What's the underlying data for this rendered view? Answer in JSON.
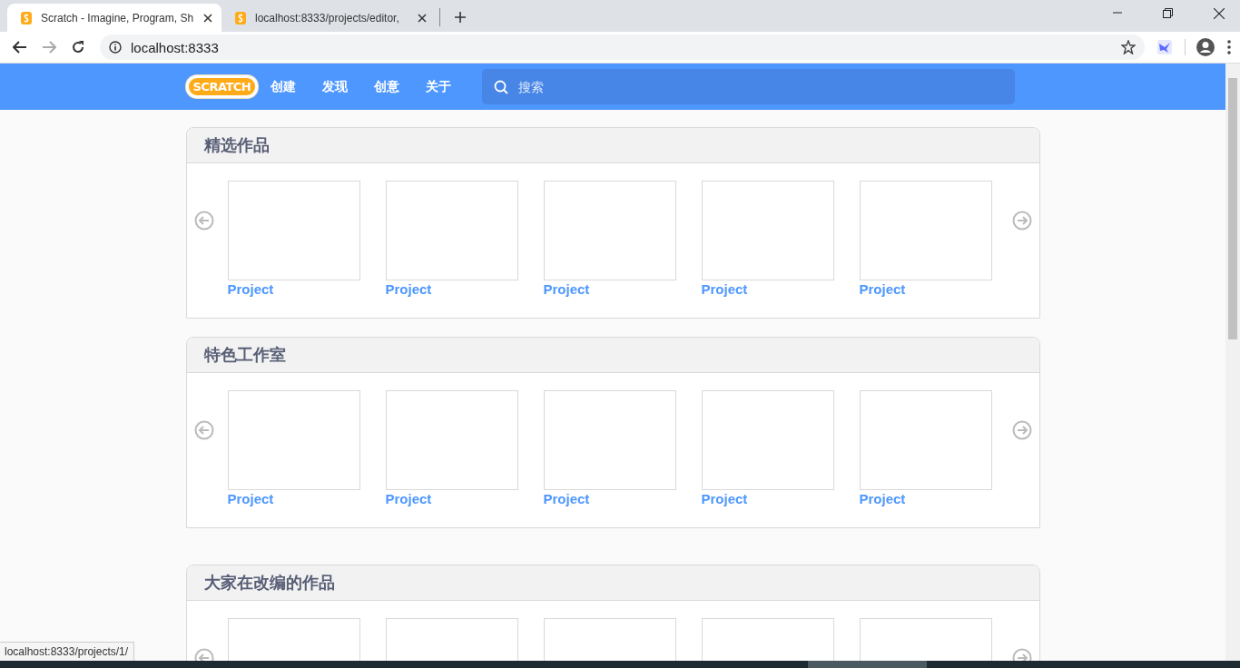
{
  "browser": {
    "tabs": [
      {
        "title": "Scratch - Imagine, Program, Sh",
        "selected": true
      },
      {
        "title": "localhost:8333/projects/editor,",
        "selected": false
      }
    ],
    "address": "localhost:8333"
  },
  "navbar": {
    "logo": "SCRATCH",
    "links": [
      "创建",
      "发现",
      "创意",
      "关于"
    ],
    "search": {
      "placeholder": "搜索"
    }
  },
  "sections": [
    {
      "title": "精选作品",
      "projects": [
        {
          "kind": "card",
          "title": "Project"
        },
        {
          "kind": "card",
          "title": "Project"
        },
        {
          "kind": "card",
          "title": "Project"
        },
        {
          "kind": "card",
          "title": "Project"
        },
        {
          "kind": "card",
          "title": "Project"
        }
      ]
    },
    {
      "title": "特色工作室",
      "projects": [
        {
          "kind": "card",
          "title": "Project"
        },
        {
          "kind": "card",
          "title": "Project"
        },
        {
          "kind": "card",
          "title": "Project"
        },
        {
          "kind": "card",
          "title": "Project"
        },
        {
          "kind": "card",
          "title": "Project"
        }
      ]
    },
    {
      "title": "大家在改编的作品",
      "projects": [
        {
          "kind": "card"
        },
        {
          "kind": "card"
        },
        {
          "kind": "card"
        },
        {
          "kind": "card"
        },
        {
          "kind": "card"
        }
      ]
    }
  ],
  "status_url": "localhost:8333/projects/1/"
}
